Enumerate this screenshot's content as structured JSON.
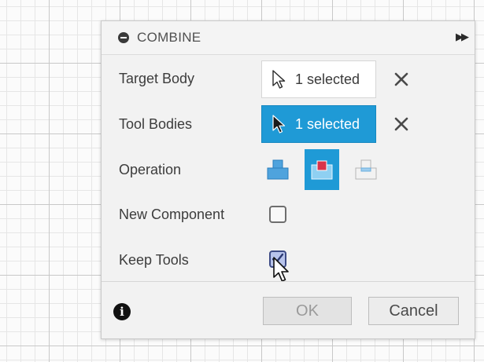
{
  "dialog": {
    "title": "COMBINE",
    "rows": {
      "target_body": {
        "label": "Target Body",
        "value": "1 selected"
      },
      "tool_bodies": {
        "label": "Tool Bodies",
        "value": "1 selected"
      },
      "operation": {
        "label": "Operation",
        "options": [
          "join",
          "cut",
          "intersect"
        ],
        "selected": "cut"
      },
      "new_component": {
        "label": "New Component",
        "checked": false
      },
      "keep_tools": {
        "label": "Keep Tools",
        "checked": true
      }
    },
    "footer": {
      "ok_label": "OK",
      "cancel_label": "Cancel",
      "info_glyph": "i"
    }
  },
  "colors": {
    "accent": "#1f9ad6",
    "grid_major": "#c8c8c8",
    "grid_minor": "#e6e6e6",
    "dialog_bg": "#f2f2f2"
  },
  "icons": {
    "header_left": "minus-circle-icon",
    "header_right": "double-chevron-right-icon",
    "selection": "arrow-cursor-icon",
    "clear": "close-icon",
    "info": "info-icon"
  }
}
